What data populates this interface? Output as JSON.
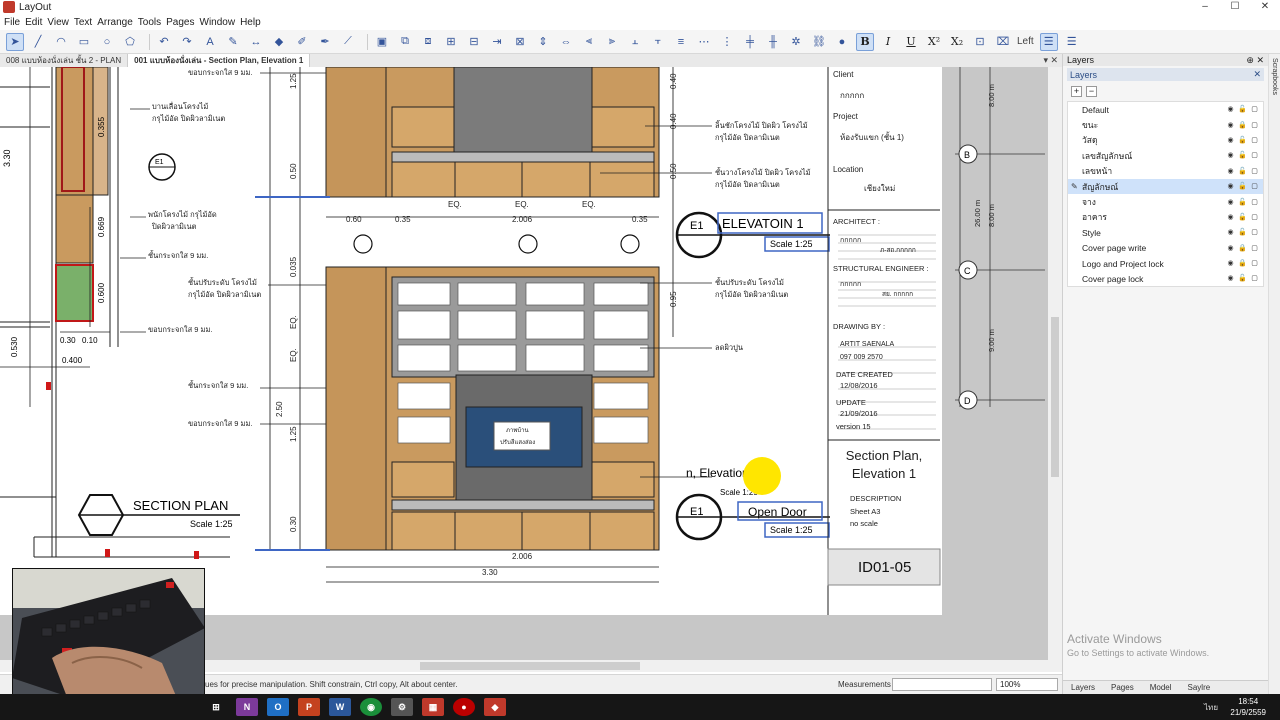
{
  "window": {
    "title": "LayOut",
    "controls": [
      "–",
      "☐",
      "✕"
    ]
  },
  "menu": [
    "File",
    "Edit",
    "View",
    "Text",
    "Arrange",
    "Tools",
    "Pages",
    "Window",
    "Help"
  ],
  "toolbar": {
    "align_label": "Left"
  },
  "tabs": [
    {
      "label": "008 แบบห้องนั่งเล่น ชั้น 2 - PLAN",
      "active": false
    },
    {
      "label": "001 แบบห้องนั่งเล่น - Section Plan, Elevation 1",
      "active": true
    }
  ],
  "drawing": {
    "elevation_label": "ELEVATOIN 1",
    "elevation_scale": "Scale 1:25",
    "section_label": "SECTION PLAN",
    "section_scale": "Scale 1:25",
    "open_door_label": "Open Door",
    "open_door_scale": "Scale 1:25",
    "marker_e1": "E1",
    "partial_label": "n, Elevation 1",
    "partial_scale": "Scale 1:25",
    "grid_b": "B",
    "grid_c": "C",
    "grid_d": "D",
    "dims": {
      "d1": "0.60",
      "d2": "0.35",
      "d3": "2.006",
      "d4": "0.35",
      "bottom1": "2.006",
      "bottom2": "3.30",
      "eq": "EQ.",
      "h1": "1.25",
      "h2": "0.50",
      "h3": "0.035",
      "h4": "EQ.",
      "h5": "2.50",
      "h6": "1.25",
      "h7": "0.30",
      "r1": "0.40",
      "r2": "0.40",
      "r3": "0.50",
      "r4": "0.95",
      "l1": "0.355",
      "l2": "0.669",
      "l3": "0.600",
      "l4": "0.30",
      "l5": "0.10",
      "l6": "0.400",
      "l7": "0.530",
      "l8": "3.30",
      "grid1": "8.00 m",
      "grid2": "26.00 m",
      "grid3": "8.00 m",
      "grid4": "9.00 m"
    },
    "notes": {
      "n1": "บานเลื่อนโครงไม้",
      "n1b": "กรุไม้อัด ปิดผิวลามิเนต",
      "n2": "ชั้นวางโครงไม้",
      "n2b": "กรุไม้อัด ปิดผิวลามิเนต",
      "n3": "พนักโครงไม้ กรุไม้อัด",
      "n3b": "ปิดผิวลามิเนต",
      "n4": "ชั้นกระจกใส 9 มม.",
      "n5": "ชั้นปรับระดับ โครงไม้",
      "n5b": "กรุไม้อัด ปิดผิวลามิเนต",
      "n6": "ขอบกระจกใส 9 มม.",
      "n7": "ชั้นกระจกใส 9 มม.",
      "n8": "ขอบกระจกใส 9 มม.",
      "n9": "ขอบกระจกใส 9 มม.",
      "n10": "ลิ้นชักโครงไม้ ปิดผิว โครงไม้",
      "n10b": "กรุไม้อัด ปิดลามิเนต",
      "n11": "ชั้นวางโครงไม้ ปิดผิว โครงไม้",
      "n11b": "กรุไม้อัด ปิดลามิเนต",
      "n12": "ชั้นปรับระดับ โครงไม้",
      "n12b": "กรุไม้อัด ปิดผิวลามิเนต",
      "n13": "ลดผิวปูน",
      "tv1": "ภาพบ้าน",
      "tv2": "ปรับสีแสงส่อง"
    }
  },
  "title_block": {
    "client_label": "Client",
    "client_value": "กกกกก",
    "project_label": "Project",
    "project_value": "ห้องรับแขก (ชั้น 1)",
    "location_label": "Location",
    "location_value": "เชียงใหม่",
    "architect_label": "ARCHITECT :",
    "architect_value": "กกกกก",
    "architect_sub": "ภ-สถ.กกกกก",
    "struct_label": "STRUCTURAL ENGINEER :",
    "struct_value": "กกกกก",
    "struct_sub": "สย. กกกกก",
    "drawing_by_label": "DRAWING BY :",
    "drawing_by_name": "ARTIT SAENALA",
    "drawing_by_phone": "097 009 2570",
    "date_label": "DATE CREATED",
    "date_value": "12/08/2016",
    "update_label": "UPDATE",
    "update_value": "21/09/2016",
    "version": "version 15",
    "sheet_title": "Section Plan, Elevation 1",
    "description_label": "DESCRIPTION",
    "sheet_size": "Sheet  A3",
    "scale_note": "no scale",
    "sheet_id": "ID01-05"
  },
  "status": {
    "hint": "ues for precise manipulation. Shift constrain, Ctrl copy, Alt about center.",
    "measurements_label": "Measurements",
    "zoom": "100%"
  },
  "layers_panel": {
    "tray_title": "Layers",
    "section_title": "Layers",
    "layers": [
      {
        "name": "Default",
        "selected": false
      },
      {
        "name": "ขนะ",
        "selected": false
      },
      {
        "name": "วัสดุ",
        "selected": false
      },
      {
        "name": "เลขสัญลักษณ์",
        "selected": false
      },
      {
        "name": "เลขหน้า",
        "selected": false
      },
      {
        "name": "สัญลักษณ์",
        "selected": true
      },
      {
        "name": "จาง",
        "selected": false
      },
      {
        "name": "อาคาร",
        "selected": false
      },
      {
        "name": "Style",
        "selected": false
      },
      {
        "name": "Cover page write",
        "selected": false
      },
      {
        "name": "Logo and Project lock",
        "selected": false
      },
      {
        "name": "Cover page lock",
        "selected": false
      }
    ],
    "activate_title": "Activate Windows",
    "activate_sub": "Go to Settings to activate Windows.",
    "tray_tabs": [
      "Layers",
      "Pages",
      "Model",
      "Saylre"
    ],
    "scrapbooks": "Scrapbooks"
  },
  "taskbar": {
    "time": "18:54",
    "date": "21/9/2559",
    "lang": "ไทย"
  },
  "colors": {
    "wood": "#c99a5f",
    "wood_dark": "#a9793f",
    "selection": "#3e66c4",
    "highlight": "#ffe600"
  }
}
